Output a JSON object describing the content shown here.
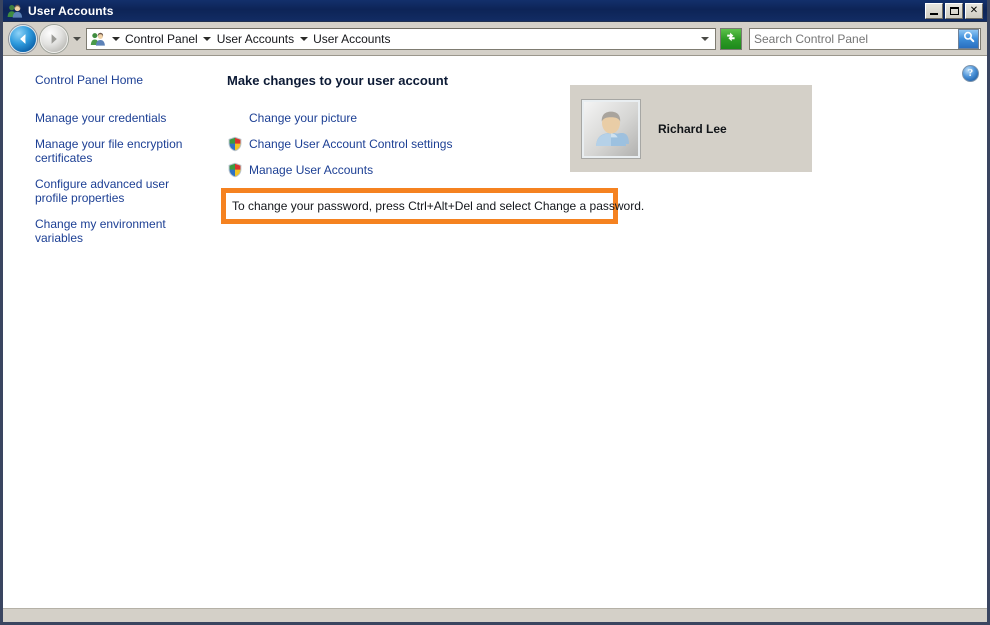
{
  "window": {
    "title": "User Accounts",
    "icon": "users-icon",
    "caption_buttons": {
      "minimize": "Minimize",
      "maximize": "Maximize",
      "close": "Close"
    }
  },
  "navbar": {
    "back_label": "Back",
    "forward_label": "Forward",
    "recent_pages_label": "Recent pages",
    "address_icon": "users-icon",
    "breadcrumbs": [
      "Control Panel",
      "User Accounts",
      "User Accounts"
    ],
    "address_dropdown_label": "Previous locations",
    "refresh_label": "Refresh",
    "search": {
      "placeholder": "Search Control Panel",
      "value": "",
      "button_label": "Search"
    }
  },
  "sidebar": {
    "items": [
      {
        "label": "Control Panel Home"
      },
      {
        "label": "Manage your credentials"
      },
      {
        "label": "Manage your file encryption certificates"
      },
      {
        "label": "Configure advanced user profile properties"
      },
      {
        "label": "Change my environment variables"
      }
    ]
  },
  "main": {
    "heading": "Make changes to your user account",
    "tasks": [
      {
        "label": "Change your picture",
        "icon": "none"
      },
      {
        "label": "Change User Account Control settings",
        "icon": "uac-shield-icon"
      },
      {
        "label": "Manage User Accounts",
        "icon": "uac-shield-icon"
      }
    ],
    "account": {
      "name": "Richard Lee",
      "avatar_icon": "user-avatar-icon"
    },
    "notice": {
      "text": "To change your password, press Ctrl+Alt+Del and select Change a password.",
      "highlight_color": "#f58220"
    },
    "help_label": "Help"
  },
  "colors": {
    "titlebar": "#0d2457",
    "chrome": "#d4d0c8",
    "link": "#1c3f94",
    "highlight": "#f58220",
    "window_border": "#3a4560"
  }
}
